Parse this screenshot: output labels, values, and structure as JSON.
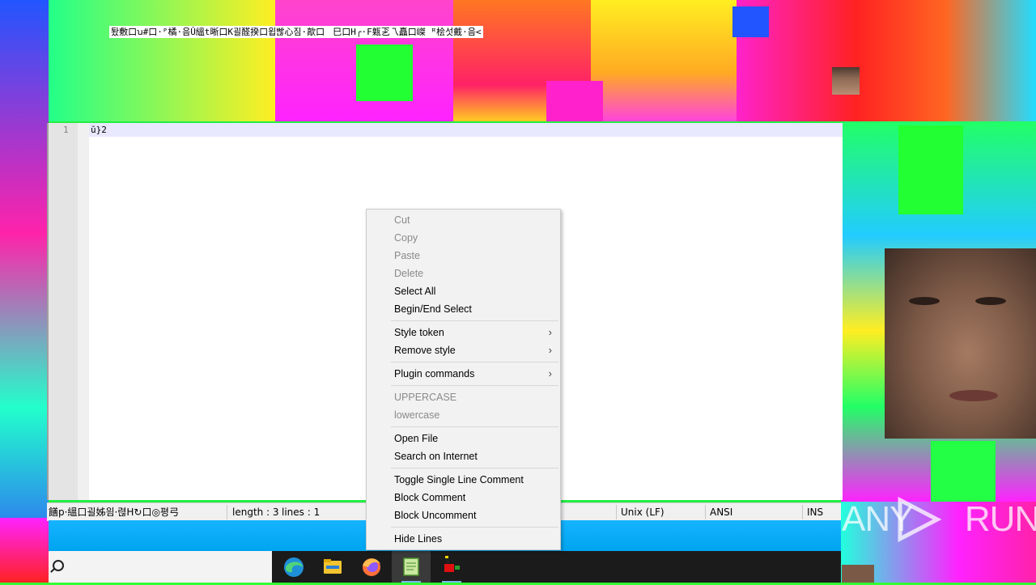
{
  "window_title": "퇐敷口ꭒ#口·ᴾ橘·음Ǔ縕t晰口K괼醛揆口윕빦心짐·歊口ᅟ巳口H╭·F甈乤乁矗口嵥 ꟸ桧섯戴·음<",
  "editor": {
    "line_numbers": [
      "1"
    ],
    "lines": [
      "ŭ}2"
    ]
  },
  "statusbar": {
    "file_type": "饍p·縕口괼姊읨·렪H↻口◎평弓",
    "length": "length : 3",
    "lines": "lines : 1",
    "eol": "Unix (LF)",
    "encoding": "ANSI",
    "mode": "INS"
  },
  "context_menu": {
    "cut": "Cut",
    "copy": "Copy",
    "paste": "Paste",
    "delete": "Delete",
    "select_all": "Select All",
    "begin_end_select": "Begin/End Select",
    "style_token": "Style token",
    "remove_style": "Remove style",
    "plugin_commands": "Plugin commands",
    "uppercase": "UPPERCASE",
    "lowercase": "lowercase",
    "open_file": "Open File",
    "search_internet": "Search on Internet",
    "toggle_comment": "Toggle Single Line Comment",
    "block_comment": "Block Comment",
    "block_uncomment": "Block Uncomment",
    "hide_lines": "Hide Lines",
    "submenu_arrow": "›"
  },
  "taskbar": {
    "apps": [
      "edge-icon",
      "file-explorer-icon",
      "firefox-icon",
      "notepad-plus-plus-icon",
      "malware-app-icon"
    ]
  },
  "watermark": "ANY RUN",
  "colors": {
    "accent": "#00a4ef",
    "menu_bg": "#f2f2f2",
    "disabled_text": "#8a8a8a"
  }
}
